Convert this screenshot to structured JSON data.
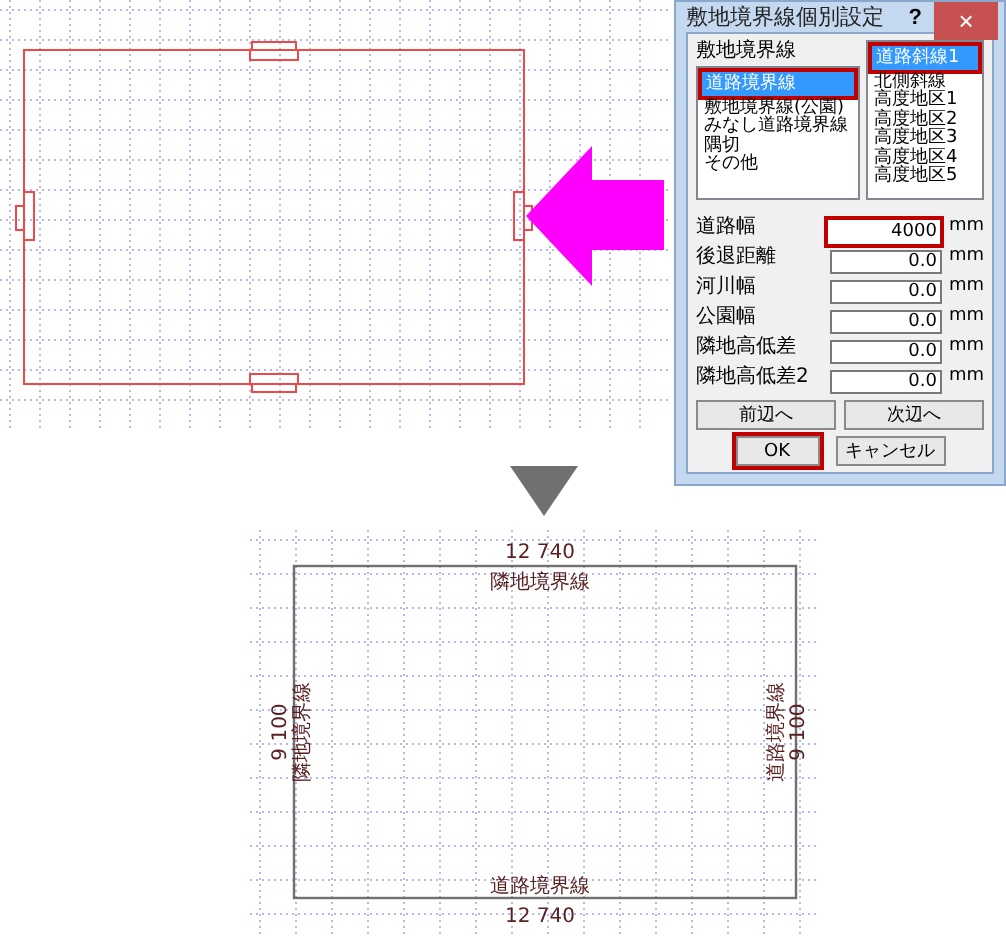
{
  "dialog": {
    "title": "敷地境界線個別設定",
    "help_button": "?",
    "close_button": "×",
    "boundary_list": {
      "header": "敷地境界線",
      "items": [
        {
          "label": "道路境界線",
          "selected": true,
          "highlighted": true
        },
        {
          "label": "敷地境界線(公園)",
          "selected": false,
          "highlighted": false
        },
        {
          "label": "みなし道路境界線",
          "selected": false,
          "highlighted": false
        },
        {
          "label": "隅切",
          "selected": false,
          "highlighted": false
        },
        {
          "label": "その他",
          "selected": false,
          "highlighted": false
        }
      ]
    },
    "slope_list": {
      "items": [
        {
          "label": "道路斜線1",
          "selected": true,
          "highlighted": true
        },
        {
          "label": "北側斜線",
          "selected": false,
          "highlighted": false
        },
        {
          "label": "高度地区1",
          "selected": false,
          "highlighted": false
        },
        {
          "label": "高度地区2",
          "selected": false,
          "highlighted": false
        },
        {
          "label": "高度地区3",
          "selected": false,
          "highlighted": false
        },
        {
          "label": "高度地区4",
          "selected": false,
          "highlighted": false
        },
        {
          "label": "高度地区5",
          "selected": false,
          "highlighted": false
        }
      ]
    },
    "fields": [
      {
        "label": "道路幅",
        "value": "4000",
        "unit": "mm",
        "highlighted": true
      },
      {
        "label": "後退距離",
        "value": "0.0",
        "unit": "mm",
        "highlighted": false
      },
      {
        "label": "河川幅",
        "value": "0.0",
        "unit": "mm",
        "highlighted": false
      },
      {
        "label": "公園幅",
        "value": "0.0",
        "unit": "mm",
        "highlighted": false
      },
      {
        "label": "隣地高低差",
        "value": "0.0",
        "unit": "mm",
        "highlighted": false
      },
      {
        "label": "隣地高低差2",
        "value": "0.0",
        "unit": "mm",
        "highlighted": false
      }
    ],
    "nav_buttons": [
      {
        "label": "前辺へ"
      },
      {
        "label": "次辺へ"
      }
    ],
    "buttons": [
      {
        "label": "OK",
        "highlighted": true
      },
      {
        "label": "キャンセル",
        "highlighted": false
      }
    ]
  },
  "result_drawing": {
    "sides": [
      {
        "kind": "top",
        "dimension": "12 740",
        "boundary": "隣地境界線"
      },
      {
        "kind": "left",
        "dimension": "9 100",
        "boundary": "隣地境界線"
      },
      {
        "kind": "right",
        "dimension": "9 100",
        "boundary": "道路境界線"
      },
      {
        "kind": "bottom",
        "dimension": "12 740",
        "boundary": "道路境界線"
      }
    ]
  }
}
